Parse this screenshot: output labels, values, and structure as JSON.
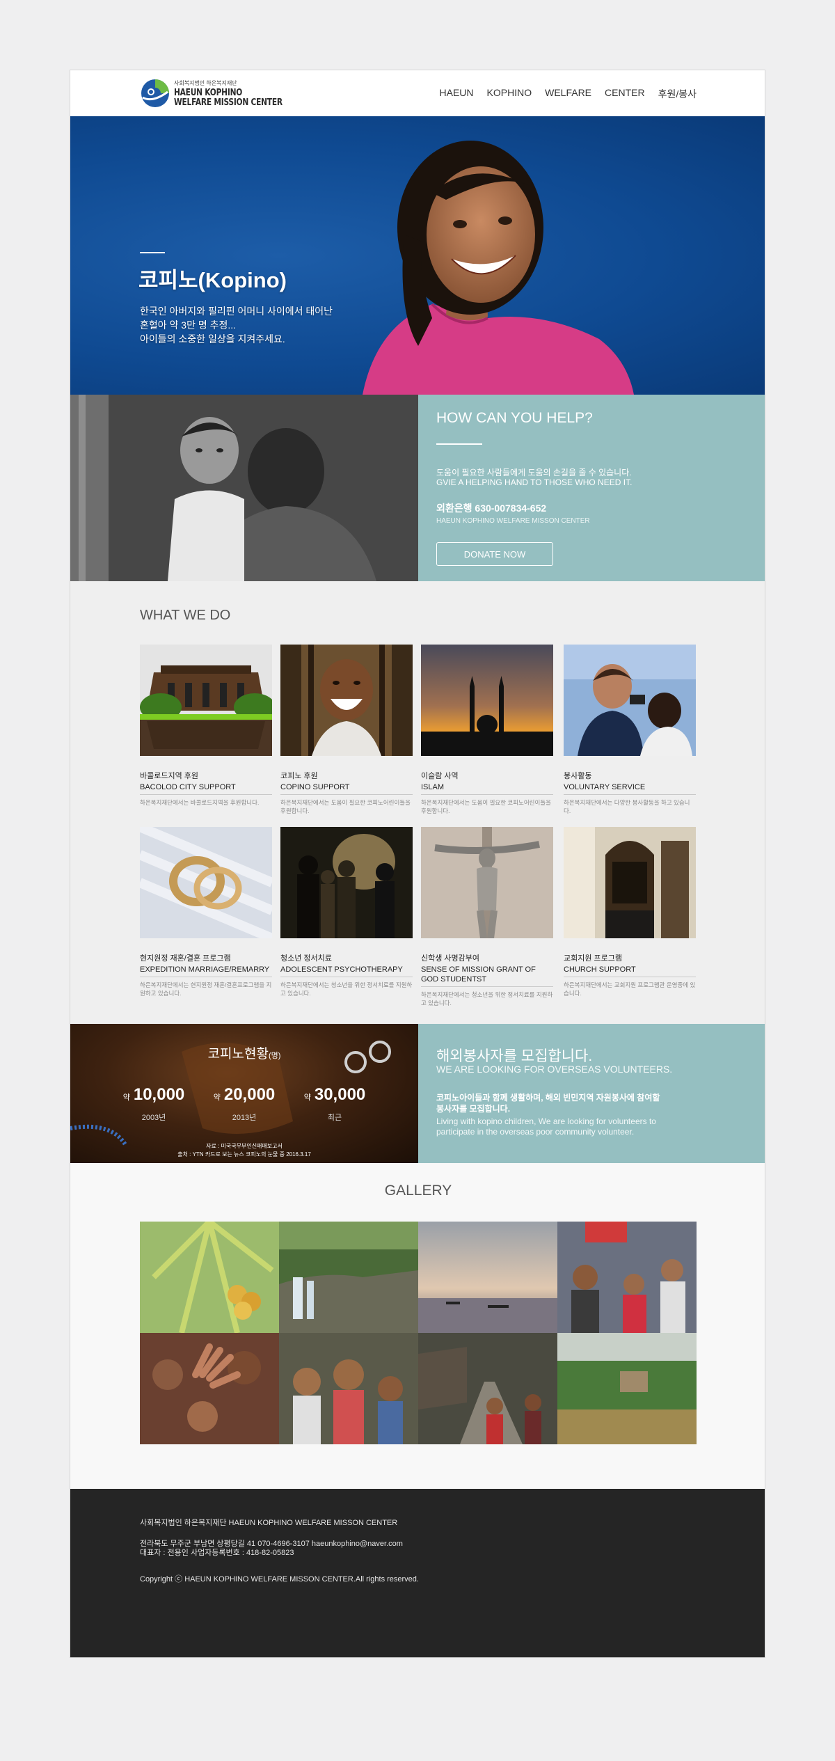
{
  "header": {
    "logo_small": "사회복지법인 하은복지재단",
    "logo_line1": "HAEUN KOPHINO",
    "logo_line2": "WELFARE MISSION CENTER",
    "nav": [
      "HAEUN",
      "KOPHINO",
      "WELFARE",
      "CENTER",
      "후원/봉사"
    ]
  },
  "hero": {
    "title": "코피노(Kopino)",
    "lines": [
      "한국인 아버지와 필리핀 어머니 사이에서 태어난",
      "혼혈아 약 3만 명 추정...",
      "아이들의 소중한 일상을 지켜주세요."
    ]
  },
  "help": {
    "title": "HOW CAN YOU HELP?",
    "text_ko": "도움이 필요한 사람들에게 도움의 손길을 줄 수 있습니다.",
    "text_en": "GVIE A HELPING HAND TO THOSE WHO NEED IT.",
    "bank": "외환은행 630-007834-652",
    "org": "HAEUN KOPHINO WELFARE MISSON CENTER",
    "donate_label": "DONATE NOW"
  },
  "what_we_do": {
    "title": "WHAT WE DO",
    "items": [
      {
        "ko": "바콜로드지역 후원",
        "en": "BACOLOD CITY SUPPORT",
        "desc": "하은복지재단에서는 바콜로드지역을 후원합니다.",
        "icon": "ruins-photo"
      },
      {
        "ko": "코피노 후원",
        "en": "COPINO SUPPORT",
        "desc": "하은복지재단에서는 도움이 필요한 코피노어린이들을 후원합니다.",
        "icon": "laughing-child-photo"
      },
      {
        "ko": "이슬람 사역",
        "en": "ISLAM",
        "desc": "하은복지재단에서는 도움이 필요한 코피노어린이들을 후원합니다.",
        "icon": "mosque-sunset-photo"
      },
      {
        "ko": "봉사활동",
        "en": "VOLUNTARY SERVICE",
        "desc": "하은복지재단에서는 다양한 봉사활동을 하고 있습니다.",
        "icon": "volunteer-photo"
      },
      {
        "ko": "현지원정 재혼/결혼 프로그램",
        "en": "EXPEDITION MARRIAGE/REMARRY",
        "desc": "하은복지재단에서는 현지원정 재혼/결혼프로그램을 지원하고 있습니다.",
        "icon": "rings-photo"
      },
      {
        "ko": "청소년 정서치료",
        "en": "ADOLESCENT PSYCHOTHERAPY",
        "desc": "하은복지재단에서는 청소년을 위한 정서치료를 지원하고 있습니다.",
        "icon": "crowd-photo"
      },
      {
        "ko": "신학생 사명감부여",
        "en": "SENSE OF MISSION GRANT OF GOD STUDENTST",
        "desc": "하은복지재단에서는 청소년을 위한 정서치료를 지원하고 있습니다.",
        "icon": "crucifix-photo"
      },
      {
        "ko": "교회지원 프로그램",
        "en": "CHURCH SUPPORT",
        "desc": "하은복지재단에서는 교회지원 프로그램관 운영중에 있습니다.",
        "icon": "church-interior-photo"
      }
    ]
  },
  "stats": {
    "title": "코피노현황",
    "title_suffix": "(명)",
    "prefix": "약",
    "items": [
      {
        "value": "10,000",
        "label": "2003년"
      },
      {
        "value": "20,000",
        "label": "2013년"
      },
      {
        "value": "30,000",
        "label": "최근"
      }
    ],
    "source1": "자료 : 미국국무부인신매매보고서",
    "source2": "출처 : YTN 카드로 보는 뉴스 코피노의 눈물 중 2016.3.17"
  },
  "volunteer": {
    "title": "해외봉사자를 모집합니다.",
    "subtitle": "WE ARE LOOKING FOR OVERSEAS VOLUNTEERS.",
    "ko1": "코피노아이들과 함께 생활하며, 해외 빈민지역 자원봉사에 참여할",
    "ko2": "봉사자를 모집합니다.",
    "en1": "Living with kopino children, We are looking for volunteers to",
    "en2": "participate in the overseas poor community volunteer."
  },
  "gallery": {
    "title": "GALLERY",
    "images": [
      "coconut-photo",
      "waterfall-photo",
      "sea-sunset-photo",
      "street-people-photo",
      "kids-hands-photo",
      "smiling-girls-photo",
      "village-road-photo",
      "riverside-village-photo"
    ]
  },
  "footer": {
    "org": "사회복지법인 하은복지재단 HAEUN KOPHINO WELFARE MISSON CENTER",
    "address": "전라북도 무주군 부남면 상평당길 41     070-4696-3107     haeunkophino@naver.com",
    "rep": "대표자 : 전용인 사업자등록번호 : 418-82-05823",
    "copyright": "Copyright ⓒ HAEUN KOPHINO WELFARE MISSON CENTER.All rights reserved."
  },
  "colors": {
    "hero_blue": "#0f4a92",
    "teal_panel": "#95bfc1",
    "footer_bg": "#252525",
    "page_bg": "#efeff0"
  }
}
